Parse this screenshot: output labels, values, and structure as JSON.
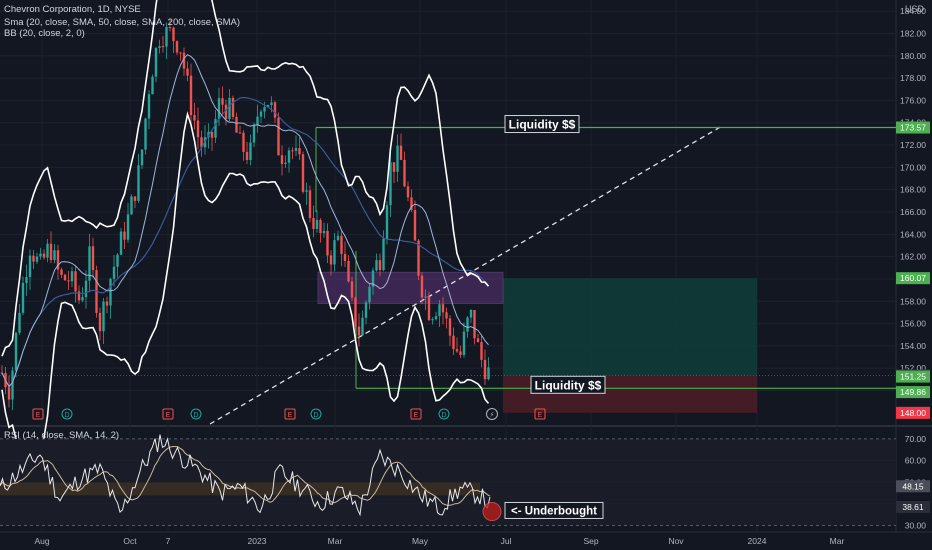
{
  "header": {
    "title": "Chevron Corporation, 1D, NYSE",
    "indicator_sma": "Sma (20, close, SMA, 50, close, SMA, 200, close, SMA)",
    "indicator_bb": "BB (20, close, 2, 0)",
    "indicator_rsi": "RSI (14, close, SMA, 14, 2)",
    "currency": "USD"
  },
  "colors": {
    "background": "#131722",
    "up": "#26a69a",
    "down": "#ef5350",
    "green_line": "#4caf50",
    "purple_zone": "#6a3a8a",
    "target_zone": "#0f3b39",
    "stop_zone": "#4a1d27",
    "sma_blue": "#3a5a96"
  },
  "chart_data": [
    {
      "type": "candlestick",
      "title": "Chevron Corporation, 1D, NYSE",
      "x_ticks": [
        "Aug",
        "Oct",
        "7",
        "2023",
        "Mar",
        "May",
        "Jul",
        "Sep",
        "Nov",
        "2024",
        "Mar"
      ],
      "y_ticks": [
        "184.00",
        "182.00",
        "180.00",
        "178.00",
        "176.00",
        "174.00",
        "172.00",
        "170.00",
        "168.00",
        "166.00",
        "164.00",
        "162.00",
        "160.00",
        "158.00",
        "156.00",
        "154.00",
        "152.00",
        "150.00"
      ],
      "ylim": [
        147,
        185
      ],
      "price_tags": [
        {
          "label": "173.57",
          "value": 173.57,
          "color": "#4caf50"
        },
        {
          "label": "160.07",
          "value": 160.07,
          "color": "#4caf50"
        },
        {
          "label": "151.35",
          "value": 151.35,
          "color": "#363a45"
        },
        {
          "label": "151.25",
          "value": 151.25,
          "color": "#4caf50"
        },
        {
          "label": "149.86",
          "value": 149.86,
          "color": "#4caf50"
        },
        {
          "label": "148.00",
          "value": 148.0,
          "color": "#f23645"
        }
      ],
      "annotations": [
        {
          "text": "Liquidity $$",
          "value": 173.57
        },
        {
          "text": "Liquidity $$",
          "value": 150.2
        }
      ],
      "close_series_anchors": [
        [
          0,
          152
        ],
        [
          10,
          150
        ],
        [
          20,
          158
        ],
        [
          30,
          163
        ],
        [
          40,
          161
        ],
        [
          50,
          163
        ],
        [
          60,
          160
        ],
        [
          70,
          160
        ],
        [
          80,
          158
        ],
        [
          90,
          162
        ],
        [
          100,
          156
        ],
        [
          110,
          160
        ],
        [
          120,
          163
        ],
        [
          130,
          166
        ],
        [
          140,
          170
        ],
        [
          150,
          178
        ],
        [
          160,
          182
        ],
        [
          170,
          182
        ],
        [
          180,
          181
        ],
        [
          190,
          176
        ],
        [
          200,
          172
        ],
        [
          210,
          172
        ],
        [
          220,
          176
        ],
        [
          230,
          175
        ],
        [
          240,
          172
        ],
        [
          250,
          171
        ],
        [
          260,
          176
        ],
        [
          270,
          176
        ],
        [
          280,
          171
        ],
        [
          290,
          172
        ],
        [
          300,
          170
        ],
        [
          310,
          166
        ],
        [
          320,
          164
        ],
        [
          330,
          162
        ],
        [
          340,
          164
        ],
        [
          350,
          158
        ],
        [
          360,
          155
        ],
        [
          370,
          160
        ],
        [
          380,
          162
        ],
        [
          390,
          170
        ],
        [
          400,
          171
        ],
        [
          410,
          166
        ],
        [
          420,
          160
        ],
        [
          430,
          157
        ],
        [
          440,
          158
        ],
        [
          450,
          155
        ],
        [
          460,
          153
        ],
        [
          470,
          157
        ],
        [
          480,
          153
        ],
        [
          490,
          151.35
        ]
      ]
    },
    {
      "type": "line",
      "title": "RSI (14, close, SMA, 14, 2)",
      "y_ticks": [
        "70.00",
        "60.00",
        "50.00",
        "40.00",
        "30.00"
      ],
      "ylim": [
        28,
        75
      ],
      "tags": [
        {
          "label": "48.15",
          "value": 48.15
        },
        {
          "label": "38.61",
          "value": 38.61
        }
      ],
      "annotation": "<- Underbought",
      "rsi_anchors": [
        [
          0,
          47
        ],
        [
          20,
          55
        ],
        [
          40,
          63
        ],
        [
          60,
          42
        ],
        [
          80,
          52
        ],
        [
          100,
          56
        ],
        [
          120,
          35
        ],
        [
          140,
          55
        ],
        [
          160,
          70
        ],
        [
          180,
          62
        ],
        [
          200,
          55
        ],
        [
          220,
          45
        ],
        [
          240,
          48
        ],
        [
          260,
          38
        ],
        [
          280,
          55
        ],
        [
          300,
          48
        ],
        [
          320,
          40
        ],
        [
          340,
          46
        ],
        [
          360,
          38
        ],
        [
          380,
          62
        ],
        [
          400,
          55
        ],
        [
          420,
          44
        ],
        [
          440,
          38
        ],
        [
          460,
          47
        ],
        [
          480,
          44
        ],
        [
          492,
          38.61
        ]
      ]
    }
  ]
}
